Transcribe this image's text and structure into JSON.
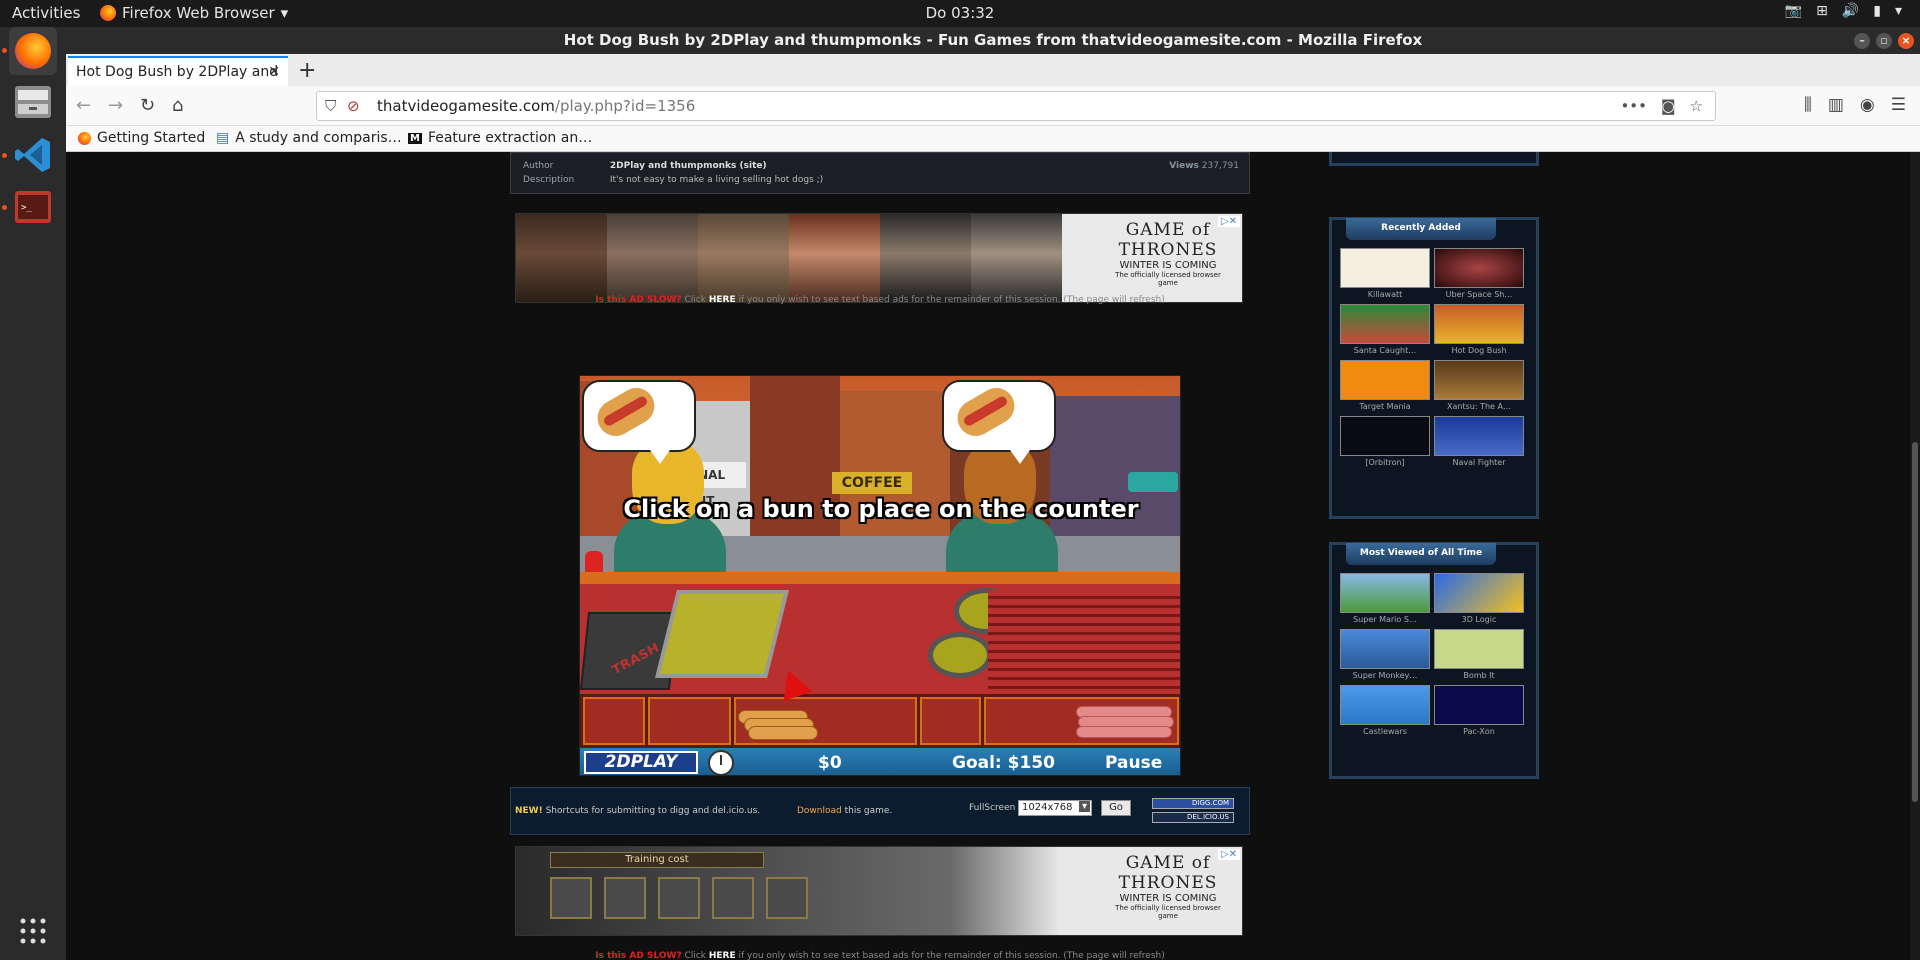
{
  "system": {
    "activities": "Activities",
    "app_menu": "Firefox Web Browser",
    "clock": "Do 03:32"
  },
  "window": {
    "title": "Hot Dog Bush by 2DPlay and thumpmonks - Fun Games from thatvideogamesite.com - Mozilla Firefox"
  },
  "browser": {
    "tab_title": "Hot Dog Bush by 2DPlay and",
    "url_host": "thatvideogamesite.com",
    "url_path": "/play.php?id=1356",
    "bookmarks": [
      "Getting Started",
      "A study and comparis…",
      "Feature extraction an…"
    ]
  },
  "game_info": {
    "author_label": "Author",
    "author_value": "2DPlay and thumpmonks (site)",
    "description_label": "Description",
    "description_value": "It's not easy to make a living selling hot dogs ;)",
    "views_label": "Views",
    "views_value": "237,791"
  },
  "ad_top": {
    "brand": "GAME of THRONES",
    "tagline": "WINTER IS COMING",
    "subtitle": "The officially licensed browser game"
  },
  "ad_bottom": {
    "header": "Training cost",
    "brand": "GAME of THRONES",
    "tagline": "WINTER IS COMING",
    "subtitle": "The officially licensed browser game"
  },
  "ad_slow": {
    "prefix": "Is this AD SLOW?",
    "click": "Click",
    "here": "HERE",
    "suffix": "if you only wish to see text based ads for the remainder of this session. (The page will refresh)"
  },
  "game": {
    "instruction": "Click on a bun to place on the counter",
    "logo": "2DPLAY",
    "money": "$0",
    "goal": "Goal: $150",
    "pause": "Pause",
    "signs": [
      "NATIONAL COUNT",
      "COFFEE"
    ],
    "trash_label": "TRASH"
  },
  "toolbar": {
    "new_label": "NEW!",
    "shortcuts_text": "Shortcuts for submitting to digg and del.icio.us.",
    "download_link": "Download",
    "download_suffix": "this game.",
    "fullscreen_label": "FullScreen",
    "resolution": "1024x768",
    "go": "Go",
    "digg": "DIGG.COM",
    "delicious": "DEL.ICIO.US"
  },
  "sidebar": {
    "recently_added_title": "Recently Added",
    "recently_added": [
      "Killawatt",
      "Uber Space Sh…",
      "Santa Caught…",
      "Hot Dog Bush",
      "Target Mania",
      "Xantsu: The A…",
      "[Orbitron]",
      "Naval Fighter"
    ],
    "most_viewed_title": "Most Viewed of All Time",
    "most_viewed": [
      "Super Mario S…",
      "3D Logic",
      "Super Monkey…",
      "Bomb It",
      "Castlewars",
      "Pac-Xon"
    ]
  }
}
